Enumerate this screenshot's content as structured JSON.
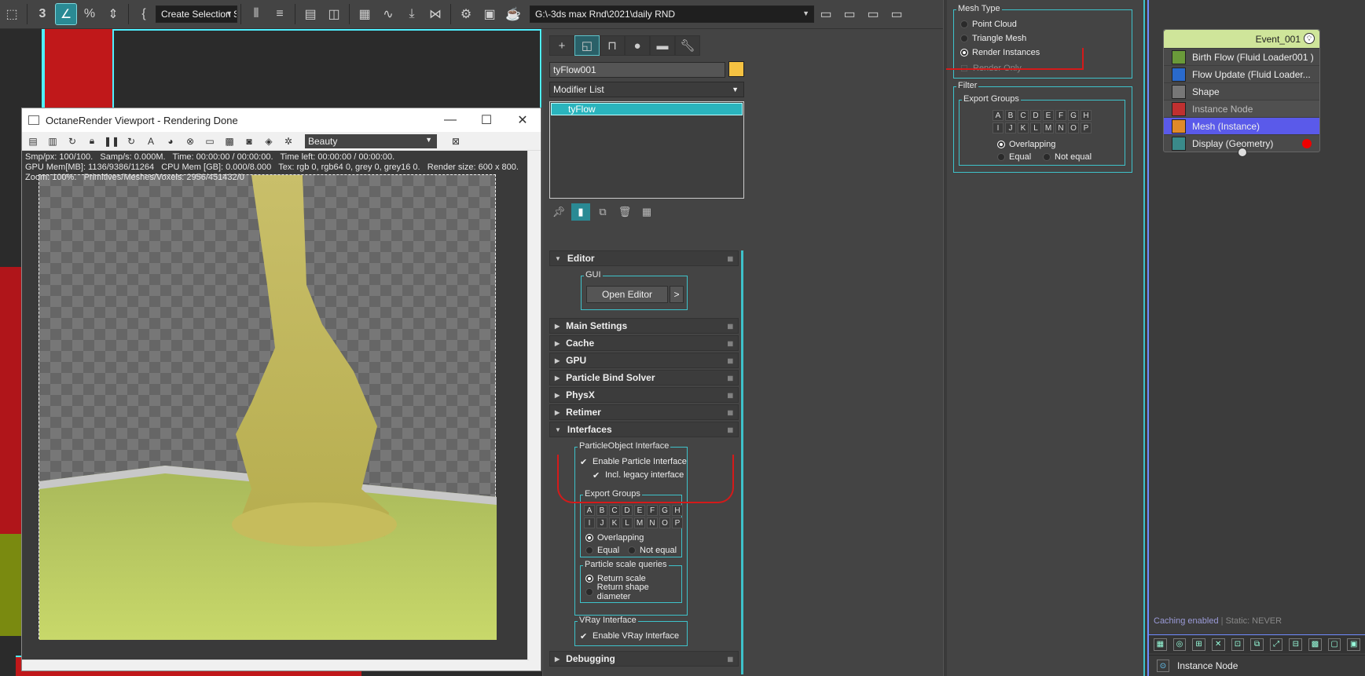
{
  "toolbar": {
    "selection_set": "Create Selection Se",
    "path": "G:\\-3ds max Rnd\\2021\\daily RND"
  },
  "octane": {
    "title": "OctaneRender Viewport - Rendering Done",
    "pass": "Beauty",
    "stats_line1": "Smp/px: 100/100.   Samp/s: 0.000M.   Time: 00:00:00 / 00:00:00.   Time left: 00:00:00 / 00:00:00.",
    "stats_line2": "GPU Mem[MB]: 1136/9386/11264   CPU Mem [GB]: 0.000/8.000   Tex: rgb 0, rgb64 0, grey 0, grey16 0.   Render size: 600 x 800.",
    "stats_line3": "Zoom: 100%.   Primitives/Meshes/Voxels: 2956/451432/0"
  },
  "cmd": {
    "object_name": "tyFlow001",
    "modifier_list": "Modifier List",
    "stack_item": "tyFlow",
    "editor": {
      "title": "Editor",
      "gui_label": "GUI",
      "open_editor": "Open Editor",
      "more": ">"
    },
    "rollouts": [
      "Main Settings",
      "Cache",
      "GPU",
      "Particle Bind Solver",
      "PhysX",
      "Retimer"
    ],
    "interfaces": {
      "title": "Interfaces",
      "particle_object_label": "ParticleObject Interface",
      "enable_particle": "Enable Particle Interface",
      "legacy": "Incl. legacy interface",
      "export_groups_label": "Export Groups",
      "letters_row1": [
        "A",
        "B",
        "C",
        "D",
        "E",
        "F",
        "G",
        "H"
      ],
      "letters_row2": [
        "I",
        "J",
        "K",
        "L",
        "M",
        "N",
        "O",
        "P"
      ],
      "overlapping": "Overlapping",
      "equal": "Equal",
      "not_equal": "Not equal",
      "scale_queries_label": "Particle scale queries",
      "return_scale": "Return scale",
      "return_shape": "Return shape diameter",
      "vray_label": "VRay Interface",
      "enable_vray": "Enable VRay Interface"
    },
    "debugging": "Debugging"
  },
  "float_panel": {
    "mesh_type_label": "Mesh Type",
    "point_cloud": "Point Cloud",
    "triangle_mesh": "Triangle Mesh",
    "render_instances": "Render Instances",
    "render_only": "Render Only",
    "filter_label": "Filter",
    "export_groups_label": "Export Groups",
    "letters_row1": [
      "A",
      "B",
      "C",
      "D",
      "E",
      "F",
      "G",
      "H"
    ],
    "letters_row2": [
      "I",
      "J",
      "K",
      "L",
      "M",
      "N",
      "O",
      "P"
    ],
    "overlapping": "Overlapping",
    "equal": "Equal",
    "not_equal": "Not equal"
  },
  "node_editor": {
    "event_title": "Event_001",
    "operators": [
      {
        "label": "Birth Flow (Fluid Loader001 )",
        "color": "#6a9a3a"
      },
      {
        "label": "Flow Update (Fluid Loader...",
        "color": "#2a6acc"
      },
      {
        "label": "Shape",
        "color": "#777777"
      },
      {
        "label": "Instance Node",
        "color": "#c03030"
      },
      {
        "label": "Mesh (Instance)",
        "color": "#e08a2a"
      },
      {
        "label": "Display (Geometry)",
        "color": "#3a8a8a"
      }
    ],
    "caching": "Caching enabled",
    "static": "Static: NEVER",
    "status": "Instance Node"
  },
  "colors": {
    "accent": "#2ab4bd",
    "selected_op": "#5a5aea",
    "event_header": "#cfe59a",
    "object_color": "#f5c242",
    "annotation_red": "#d41a1a"
  }
}
